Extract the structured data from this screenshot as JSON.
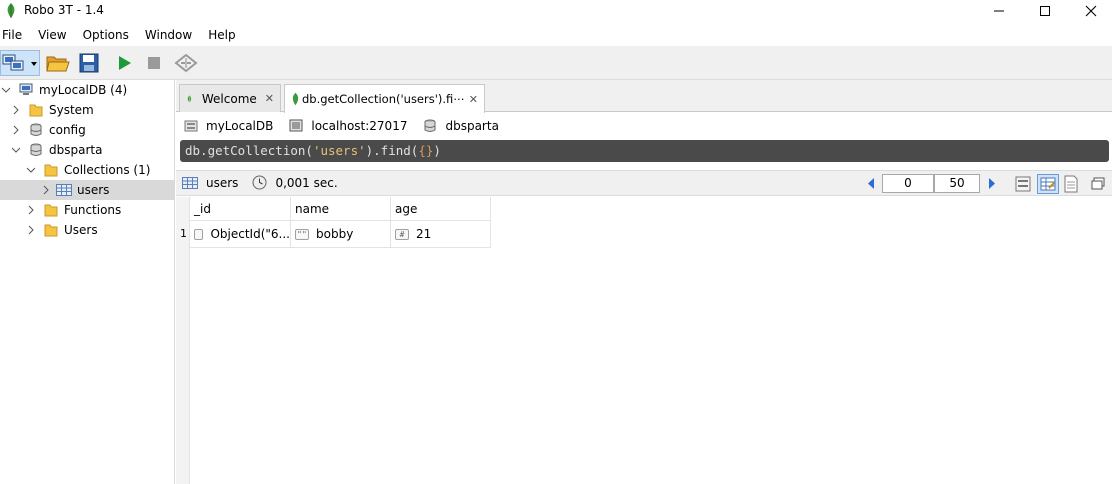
{
  "window": {
    "title": "Robo 3T - 1.4"
  },
  "menu": [
    "File",
    "View",
    "Options",
    "Window",
    "Help"
  ],
  "sidebar": {
    "connection": "myLocalDB (4)",
    "items": [
      {
        "label": "System"
      },
      {
        "label": "config"
      },
      {
        "label": "dbsparta"
      },
      {
        "label": "Collections (1)"
      },
      {
        "label": "users"
      },
      {
        "label": "Functions"
      },
      {
        "label": "Users"
      }
    ]
  },
  "tabs": [
    {
      "label": "Welcome"
    },
    {
      "label": "db.getCollection('users').fi⋯"
    }
  ],
  "conn": {
    "name": "myLocalDB",
    "host": "localhost:27017",
    "db": "dbsparta"
  },
  "query": {
    "p1": "db.getCollection(",
    "p2": "'users'",
    "p3": ").find(",
    "p4": "{}",
    "p5": ")"
  },
  "results": {
    "collection": "users",
    "time": "0,001 sec.",
    "skip": "0",
    "limit": "50"
  },
  "grid": {
    "headers": [
      "_id",
      "name",
      "age"
    ],
    "rows": [
      {
        "num": "1",
        "id": "ObjectId(\"6...",
        "name": "bobby",
        "age": "21",
        "name_type": "\"\"",
        "age_type": "#"
      }
    ]
  },
  "colors": {
    "accent": "#2b6cd6",
    "play": "#1f9a3a",
    "folder": "#f5c542"
  }
}
